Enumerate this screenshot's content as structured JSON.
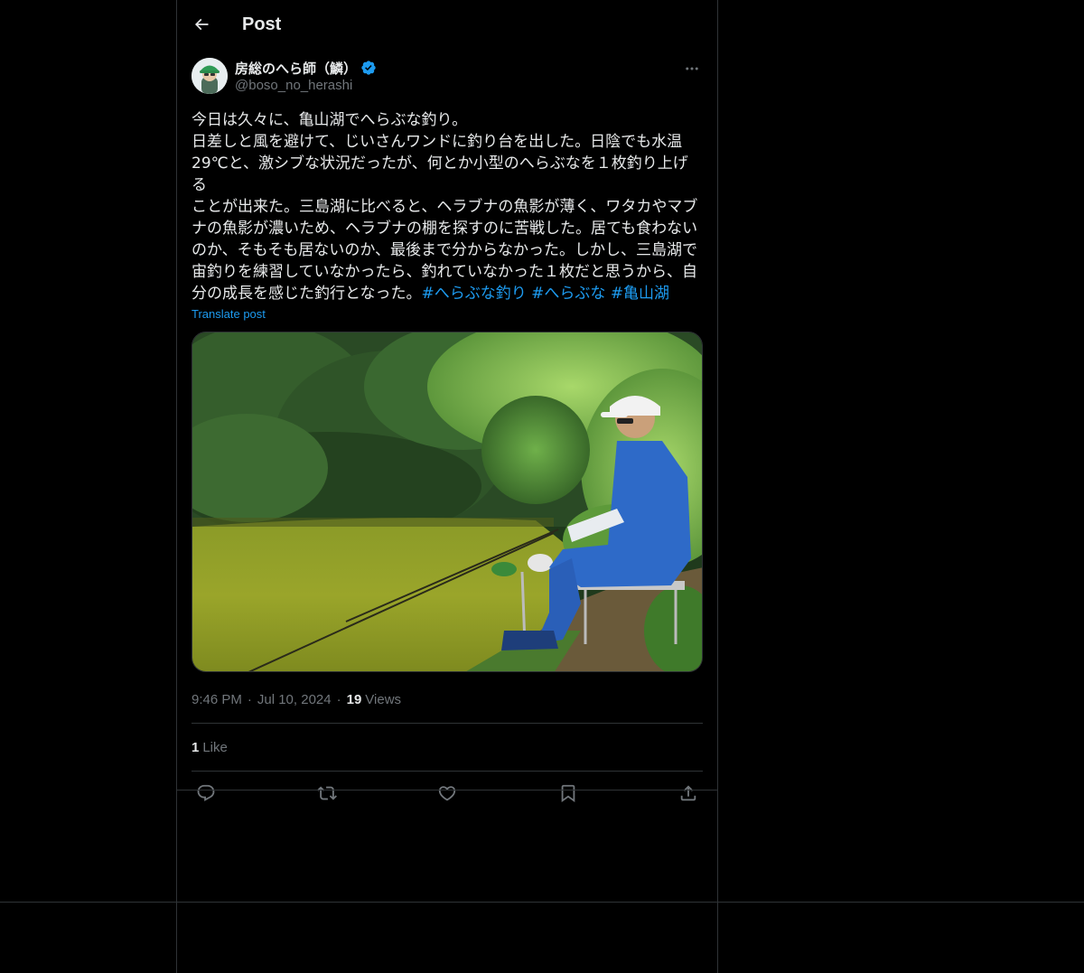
{
  "header": {
    "title": "Post"
  },
  "post": {
    "display_name": "房総のへら師（鱗）",
    "handle": "@boso_no_herashi",
    "text_lines": [
      "今日は久々に、亀山湖でへらぶな釣り。",
      "日差しと風を避けて、じいさんワンドに釣り台を出した。日陰でも水温",
      "29℃と、激シブな状況だったが、何とか小型のへらぶなを１枚釣り上げる",
      "ことが出来た。三島湖に比べると、ヘラブナの魚影が薄く、ワタカやマブ",
      "ナの魚影が濃いため、ヘラブナの棚を探すのに苦戦した。居ても食わない",
      "のか、そもそも居ないのか、最後まで分からなかった。しかし、三島湖で",
      "宙釣りを練習していなかったら、釣れていなかった１枚だと思うから、自",
      "分の成長を感じた釣行となった。"
    ],
    "hashtags": [
      "#へらぶな釣り",
      "#へらぶな",
      "#亀山湖"
    ],
    "translate_label": "Translate post",
    "time": "9:46 PM",
    "date": "Jul 10, 2024",
    "views_count": "19",
    "views_label": "Views",
    "likes_count": "1",
    "likes_label": "Like"
  },
  "colors": {
    "accent": "#1d9bf0",
    "text": "#e7e9ea",
    "muted": "#71767b",
    "border": "#2f3336",
    "background": "#000000"
  },
  "icons": {
    "back": "arrow-left-icon",
    "verified": "verified-badge-icon",
    "more": "more-horizontal-icon",
    "reply": "reply-icon",
    "repost": "repost-icon",
    "like": "heart-icon",
    "bookmark": "bookmark-icon",
    "share": "share-icon"
  }
}
